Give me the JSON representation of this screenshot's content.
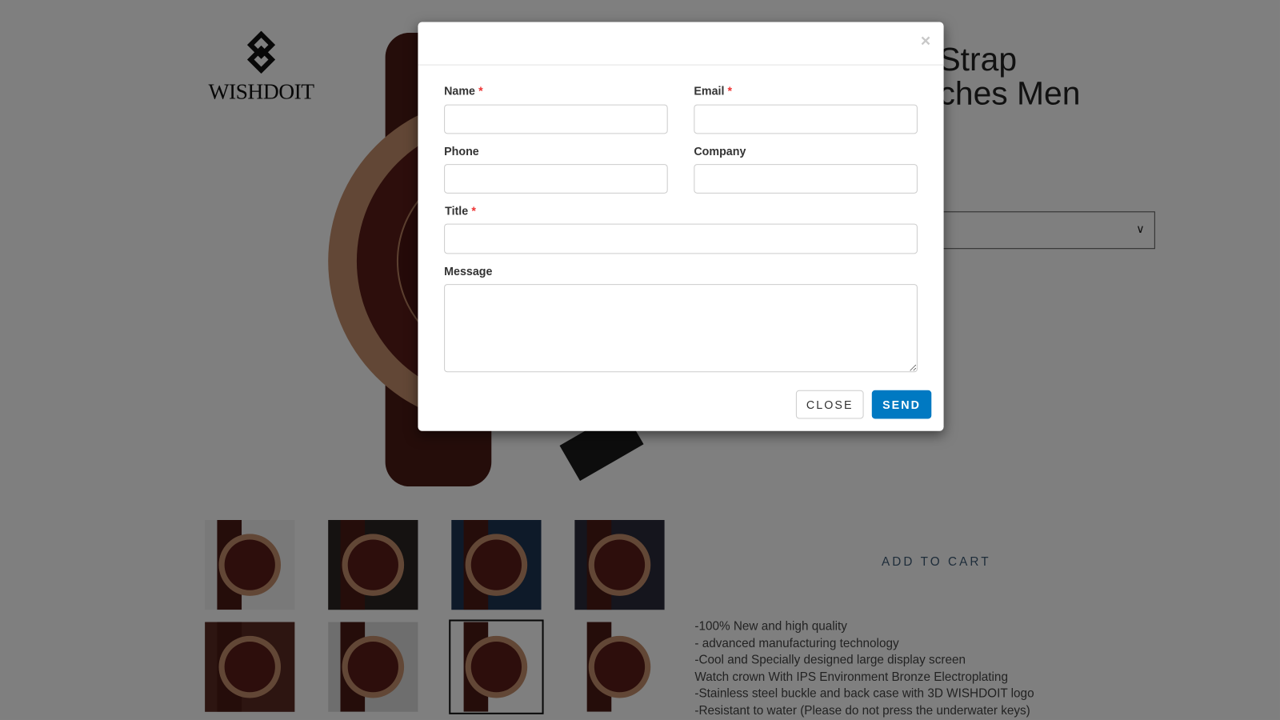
{
  "brand": {
    "logo_text": "WISHDOIT"
  },
  "product": {
    "title_visible_lines": [
      "Strap",
      "ches Men"
    ],
    "add_to_cart_label": "ADD TO CART",
    "description_lines": [
      "-100% New and high quality",
      "- advanced manufacturing technology",
      "-Cool and Specially designed large display screen",
      "Watch crown With IPS Environment Bronze Electroplating",
      "-Stainless steel buckle and back case with 3D WISHDOIT logo",
      "-Resistant to water (Please do not press the underwater keys)"
    ],
    "thumbnail_count": 8,
    "selected_thumbnail": 7
  },
  "modal": {
    "close_icon": "×",
    "fields": {
      "name": {
        "label": "Name",
        "required": "*",
        "value": ""
      },
      "email": {
        "label": "Email",
        "required": "*",
        "value": ""
      },
      "phone": {
        "label": "Phone",
        "value": ""
      },
      "company": {
        "label": "Company",
        "value": ""
      },
      "title": {
        "label": "Title",
        "required": "*",
        "value": ""
      },
      "message": {
        "label": "Message",
        "value": ""
      }
    },
    "close_label": "CLOSE",
    "send_label": "SEND"
  },
  "colors": {
    "send_button": "#0079c2",
    "required_marker": "#e33333",
    "overlay": "rgba(0,0,0,0.5)",
    "add_to_cart": "#3d5a75"
  }
}
